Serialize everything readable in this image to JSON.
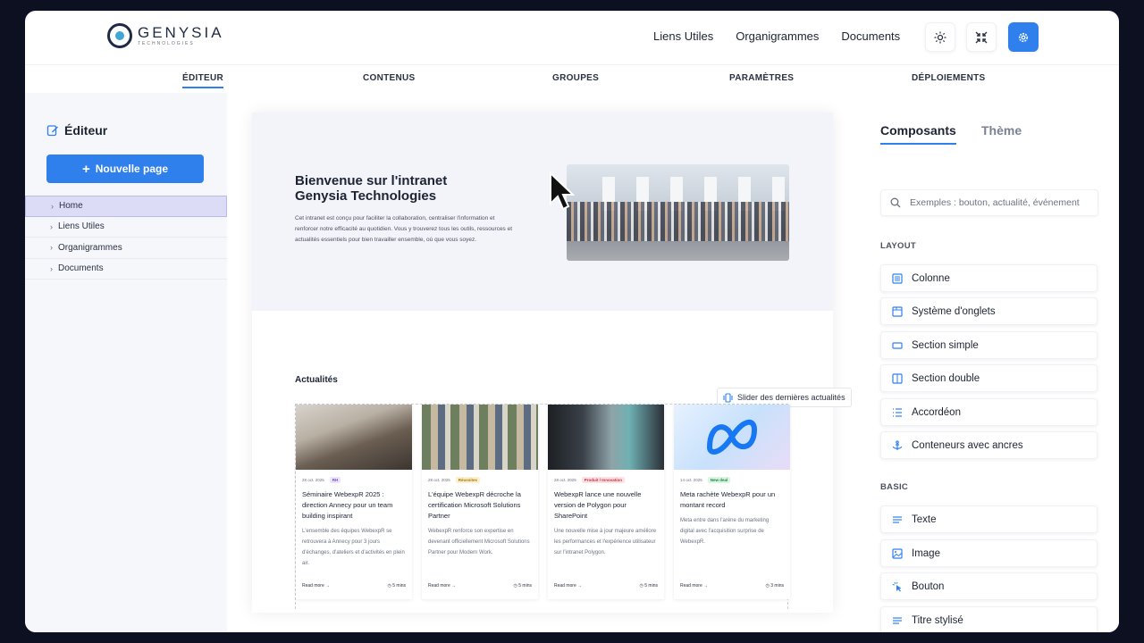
{
  "brand": {
    "name": "GENYSIA",
    "sub": "TECHNOLOGIES"
  },
  "topnav": [
    "Liens Utiles",
    "Organigrammes",
    "Documents"
  ],
  "tabs": [
    "ÉDITEUR",
    "CONTENUS",
    "GROUPES",
    "PARAMÈTRES",
    "DÉPLOIEMENTS"
  ],
  "sidebar": {
    "title": "Éditeur",
    "new_page": "Nouvelle page",
    "items": [
      "Home",
      "Liens Utiles",
      "Organigrammes",
      "Documents"
    ]
  },
  "hero": {
    "title": "Bienvenue sur l'intranet Genysia Technologies",
    "text": "Cet intranet est conçu pour faciliter la collaboration, centraliser l'information et renforcer notre efficacité au quotidien. Vous y trouverez tous les outils, ressources et actualités essentiels pour bien travailler ensemble, où que vous soyez."
  },
  "news": {
    "title": "Actualités",
    "slider_label": "Slider des dernières actualités",
    "cards": [
      {
        "date": "28 oct. 2025",
        "tag": "RH",
        "tag_bg": "#ede4fb",
        "tag_color": "#7b4fd0",
        "title": "Séminaire WebexpR 2025 : direction Annecy pour un team building inspirant",
        "desc": "L'ensemble des équipes WebexpR se retrouvera à Annecy pour 3 jours d'échanges, d'ateliers et d'activités en plein air.",
        "read": "Read more →",
        "time": "5 mins"
      },
      {
        "date": "28 oct. 2025",
        "tag": "Réussites",
        "tag_bg": "#fdf0cf",
        "tag_color": "#a37a07",
        "title": "L'équipe WebexpR décroche la certification Microsoft Solutions Partner",
        "desc": "WebexpR renforce son expertise en devenant officiellement Microsoft Solutions Partner pour Modern Work.",
        "read": "Read more →",
        "time": "5 mins"
      },
      {
        "date": "28 oct. 2025",
        "tag": "Produit / Innovation",
        "tag_bg": "#fde2e4",
        "tag_color": "#c2334a",
        "title": "WebexpR lance une nouvelle version de Polygon pour SharePoint",
        "desc": "Une nouvelle mise à jour majeure améliore les performances et l'expérience utilisateur sur l'intranet Polygon.",
        "read": "Read more →",
        "time": "5 mins"
      },
      {
        "date": "14 oct. 2025",
        "tag": "New deal",
        "tag_bg": "#dcf5e3",
        "tag_color": "#1c8a45",
        "title": "Meta rachète WebexpR pour un montant record",
        "desc": "Meta entre dans l'arène du marketing digital avec l'acquisition surprise de WebexpR.",
        "read": "Read more →",
        "time": "3 mins"
      }
    ]
  },
  "panel": {
    "tabs": [
      "Composants",
      "Thème"
    ],
    "search_placeholder": "Exemples : bouton, actualité, événement",
    "layout_label": "LAYOUT",
    "layout_items": [
      {
        "label": "Colonne",
        "icon": "column-icon"
      },
      {
        "label": "Système d'onglets",
        "icon": "tabs-icon"
      },
      {
        "label": "Section simple",
        "icon": "section-simple-icon"
      },
      {
        "label": "Section double",
        "icon": "section-double-icon"
      },
      {
        "label": "Accordéon",
        "icon": "accordion-icon"
      },
      {
        "label": "Conteneurs avec ancres",
        "icon": "anchor-icon"
      }
    ],
    "basic_label": "BASIC",
    "basic_items": [
      {
        "label": "Texte",
        "icon": "text-icon"
      },
      {
        "label": "Image",
        "icon": "image-icon"
      },
      {
        "label": "Bouton",
        "icon": "button-icon"
      },
      {
        "label": "Titre stylisé",
        "icon": "styled-title-icon"
      }
    ]
  },
  "colors": {
    "accent": "#2f80ed",
    "active_tree": "#dcdcf7"
  }
}
